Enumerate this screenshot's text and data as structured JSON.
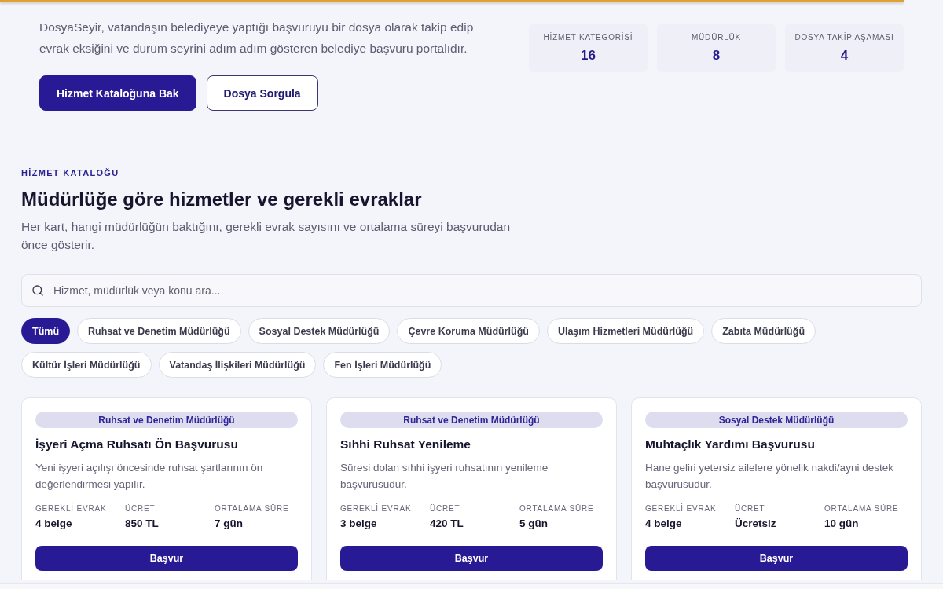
{
  "hero": {
    "description": "DosyaSeyir, vatandaşın belediyeye yaptığı başvuruyu bir dosya olarak takip edip evrak eksiğini ve durum seyrini adım adım gösteren belediye başvuru portalıdır.",
    "buttons": [
      {
        "label": "Hizmet Kataloğuna Bak",
        "kind": "primary"
      },
      {
        "label": "Dosya Sorgula",
        "kind": "secondary"
      }
    ],
    "stats": [
      {
        "label": "HİZMET KATEGORİSİ",
        "value": "16"
      },
      {
        "label": "MÜDÜRLÜK",
        "value": "8"
      },
      {
        "label": "DOSYA TAKİP AŞAMASI",
        "value": "4"
      }
    ]
  },
  "catalog": {
    "eyebrow": "HİZMET KATALOĞU",
    "title": "Müdürlüğe göre hizmetler ve gerekli evraklar",
    "subtitle": "Her kart, hangi müdürlüğün baktığını, gerekli evrak sayısını ve ortalama süreyi başvurudan önce gösterir.",
    "search": {
      "placeholder": "Hizmet, müdürlük veya konu ara..."
    },
    "filters": [
      {
        "label": "Tümü",
        "selected": true
      },
      {
        "label": "Ruhsat ve Denetim Müdürlüğü",
        "selected": false
      },
      {
        "label": "Sosyal Destek Müdürlüğü",
        "selected": false
      },
      {
        "label": "Çevre Koruma Müdürlüğü",
        "selected": false
      },
      {
        "label": "Ulaşım Hizmetleri Müdürlüğü",
        "selected": false
      },
      {
        "label": "Zabıta Müdürlüğü",
        "selected": false
      },
      {
        "label": "Kültür İşleri Müdürlüğü",
        "selected": false
      },
      {
        "label": "Vatandaş İlişkileri Müdürlüğü",
        "selected": false
      },
      {
        "label": "Fen İşleri Müdürlüğü",
        "selected": false
      }
    ],
    "cards": [
      {
        "department": "Ruhsat ve Denetim Müdürlüğü",
        "title": "İşyeri Açma Ruhsatı Ön Başvurusu",
        "description": "Yeni işyeri açılışı öncesinde ruhsat şartlarının ön değerlendirmesi yapılır.",
        "meta": [
          {
            "label": "GEREKLİ EVRAK",
            "value": "4 belge"
          },
          {
            "label": "ÜCRET",
            "value": "850 TL"
          },
          {
            "label": "ORTALAMA SÜRE",
            "value": "7 gün"
          }
        ],
        "button": "Başvur"
      },
      {
        "department": "Ruhsat ve Denetim Müdürlüğü",
        "title": "Sıhhi Ruhsat Yenileme",
        "description": "Süresi dolan sıhhi işyeri ruhsatının yenileme başvurusudur.",
        "meta": [
          {
            "label": "GEREKLİ EVRAK",
            "value": "3 belge"
          },
          {
            "label": "ÜCRET",
            "value": "420 TL"
          },
          {
            "label": "ORTALAMA SÜRE",
            "value": "5 gün"
          }
        ],
        "button": "Başvur"
      },
      {
        "department": "Sosyal Destek Müdürlüğü",
        "title": "Muhtaçlık Yardımı Başvurusu",
        "description": "Hane geliri yetersiz ailelere yönelik nakdi/ayni destek başvurusudur.",
        "meta": [
          {
            "label": "GEREKLİ EVRAK",
            "value": "4 belge"
          },
          {
            "label": "ÜCRET",
            "value": "Ücretsiz"
          },
          {
            "label": "ORTALAMA SÜRE",
            "value": "10 gün"
          }
        ],
        "button": "Başvur"
      }
    ]
  }
}
